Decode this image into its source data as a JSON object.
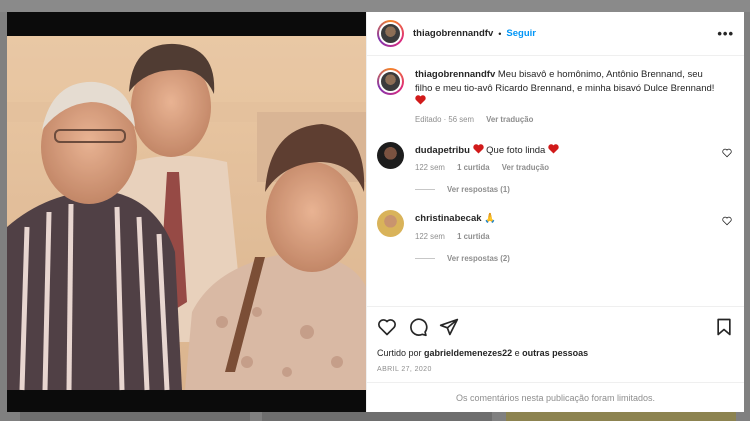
{
  "post": {
    "username": "thiagobrennandfv",
    "separator": "•",
    "follow_label": "Seguir",
    "more_label": "•••",
    "caption": {
      "username": "thiagobrennandfv",
      "text": "Meu bisavô e homônimo, Antônio Brennand, seu filho e meu tio-avô Ricardo Brennand, e minha bisavó Dulce Brennand!",
      "edited": "Editado · 56 sem",
      "translate": "Ver tradução"
    },
    "comments": [
      {
        "username": "dudapetribu",
        "text": "Que foto linda",
        "time": "122 sem",
        "likes": "1 curtida",
        "translate": "Ver tradução",
        "replies": "Ver respostas (1)"
      },
      {
        "username": "christinabecak",
        "text": "🙏",
        "time": "122 sem",
        "likes": "1 curtida",
        "replies": "Ver respostas (2)"
      }
    ],
    "liked_prefix": "Curtido por",
    "liked_user": "gabrieldemenezes22",
    "liked_and": "e",
    "liked_others": "outras pessoas",
    "date": "ABRIL 27, 2020",
    "comments_limited": "Os comentários nesta publicação foram limitados."
  },
  "icons": {
    "like": "heart-outline-icon",
    "comment": "comment-icon",
    "share": "paper-plane-icon",
    "save": "bookmark-icon",
    "red_heart": "red-heart-emoji"
  },
  "colors": {
    "accent": "#0095f6",
    "muted": "#8e8e8e",
    "heart": "#d11a1a"
  }
}
